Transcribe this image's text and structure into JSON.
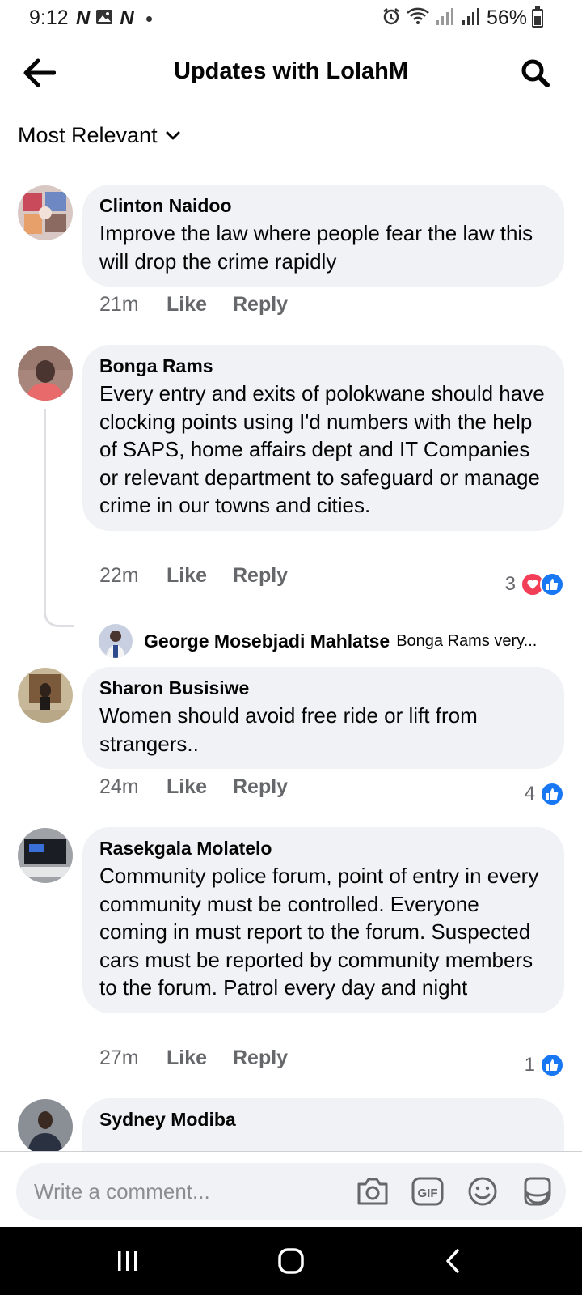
{
  "status_bar": {
    "time": "9:12",
    "battery": "56%"
  },
  "header": {
    "title": "Updates with LolahM"
  },
  "sort": {
    "label": "Most Relevant"
  },
  "comments": [
    {
      "author": "Clinton Naidoo",
      "text": "Improve the law where people fear the law this will drop the crime rapidly",
      "time": "21m",
      "like_label": "Like",
      "reply_label": "Reply"
    },
    {
      "author": "Bonga Rams",
      "text": "Every entry and exits of polokwane should have clocking points using I'd numbers with the help of SAPS, home affairs dept and IT Companies or relevant department to safeguard or manage crime in our towns and cities.",
      "time": "22m",
      "like_label": "Like",
      "reply_label": "Reply",
      "reaction_count": "3",
      "reactions": [
        "love-icon",
        "like-icon"
      ],
      "reply": {
        "author": "George Mosebjadi Mahlatse",
        "snippet": "Bonga Rams very..."
      }
    },
    {
      "author": "Sharon Busisiwe",
      "text": "Women should avoid free ride or lift from strangers..",
      "time": "24m",
      "like_label": "Like",
      "reply_label": "Reply",
      "reaction_count": "4",
      "reactions": [
        "like-icon"
      ]
    },
    {
      "author": "Rasekgala Molatelo",
      "text": "Community police forum, point of entry in every community must  be controlled. Everyone coming in must report to the forum. Suspected cars must be reported by community members to the forum. Patrol every day and night",
      "time": "27m",
      "like_label": "Like",
      "reply_label": "Reply",
      "reaction_count": "1",
      "reactions": [
        "like-icon"
      ]
    },
    {
      "author": "Sydney Modiba"
    }
  ],
  "composer": {
    "placeholder": "Write a comment..."
  },
  "colors": {
    "like": "#1877f2",
    "love": "#f33e58",
    "bubble": "#f0f2f5",
    "secondary_text": "#65676b"
  }
}
